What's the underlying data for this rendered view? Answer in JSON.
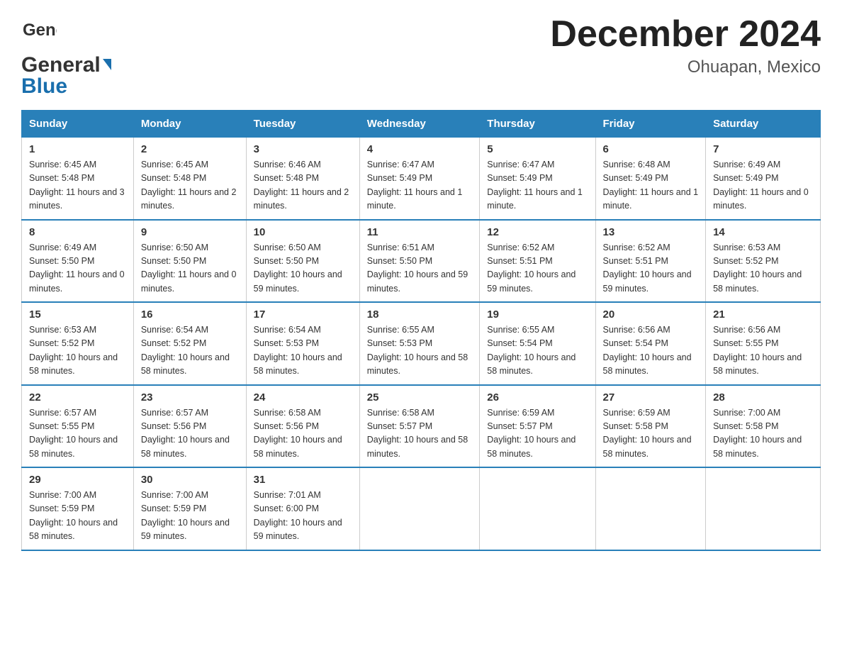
{
  "header": {
    "logo_line1": "General",
    "logo_line2": "Blue",
    "title": "December 2024",
    "subtitle": "Ohuapan, Mexico"
  },
  "days_of_week": [
    "Sunday",
    "Monday",
    "Tuesday",
    "Wednesday",
    "Thursday",
    "Friday",
    "Saturday"
  ],
  "weeks": [
    [
      {
        "day": "1",
        "sunrise": "Sunrise: 6:45 AM",
        "sunset": "Sunset: 5:48 PM",
        "daylight": "Daylight: 11 hours and 3 minutes."
      },
      {
        "day": "2",
        "sunrise": "Sunrise: 6:45 AM",
        "sunset": "Sunset: 5:48 PM",
        "daylight": "Daylight: 11 hours and 2 minutes."
      },
      {
        "day": "3",
        "sunrise": "Sunrise: 6:46 AM",
        "sunset": "Sunset: 5:48 PM",
        "daylight": "Daylight: 11 hours and 2 minutes."
      },
      {
        "day": "4",
        "sunrise": "Sunrise: 6:47 AM",
        "sunset": "Sunset: 5:49 PM",
        "daylight": "Daylight: 11 hours and 1 minute."
      },
      {
        "day": "5",
        "sunrise": "Sunrise: 6:47 AM",
        "sunset": "Sunset: 5:49 PM",
        "daylight": "Daylight: 11 hours and 1 minute."
      },
      {
        "day": "6",
        "sunrise": "Sunrise: 6:48 AM",
        "sunset": "Sunset: 5:49 PM",
        "daylight": "Daylight: 11 hours and 1 minute."
      },
      {
        "day": "7",
        "sunrise": "Sunrise: 6:49 AM",
        "sunset": "Sunset: 5:49 PM",
        "daylight": "Daylight: 11 hours and 0 minutes."
      }
    ],
    [
      {
        "day": "8",
        "sunrise": "Sunrise: 6:49 AM",
        "sunset": "Sunset: 5:50 PM",
        "daylight": "Daylight: 11 hours and 0 minutes."
      },
      {
        "day": "9",
        "sunrise": "Sunrise: 6:50 AM",
        "sunset": "Sunset: 5:50 PM",
        "daylight": "Daylight: 11 hours and 0 minutes."
      },
      {
        "day": "10",
        "sunrise": "Sunrise: 6:50 AM",
        "sunset": "Sunset: 5:50 PM",
        "daylight": "Daylight: 10 hours and 59 minutes."
      },
      {
        "day": "11",
        "sunrise": "Sunrise: 6:51 AM",
        "sunset": "Sunset: 5:50 PM",
        "daylight": "Daylight: 10 hours and 59 minutes."
      },
      {
        "day": "12",
        "sunrise": "Sunrise: 6:52 AM",
        "sunset": "Sunset: 5:51 PM",
        "daylight": "Daylight: 10 hours and 59 minutes."
      },
      {
        "day": "13",
        "sunrise": "Sunrise: 6:52 AM",
        "sunset": "Sunset: 5:51 PM",
        "daylight": "Daylight: 10 hours and 59 minutes."
      },
      {
        "day": "14",
        "sunrise": "Sunrise: 6:53 AM",
        "sunset": "Sunset: 5:52 PM",
        "daylight": "Daylight: 10 hours and 58 minutes."
      }
    ],
    [
      {
        "day": "15",
        "sunrise": "Sunrise: 6:53 AM",
        "sunset": "Sunset: 5:52 PM",
        "daylight": "Daylight: 10 hours and 58 minutes."
      },
      {
        "day": "16",
        "sunrise": "Sunrise: 6:54 AM",
        "sunset": "Sunset: 5:52 PM",
        "daylight": "Daylight: 10 hours and 58 minutes."
      },
      {
        "day": "17",
        "sunrise": "Sunrise: 6:54 AM",
        "sunset": "Sunset: 5:53 PM",
        "daylight": "Daylight: 10 hours and 58 minutes."
      },
      {
        "day": "18",
        "sunrise": "Sunrise: 6:55 AM",
        "sunset": "Sunset: 5:53 PM",
        "daylight": "Daylight: 10 hours and 58 minutes."
      },
      {
        "day": "19",
        "sunrise": "Sunrise: 6:55 AM",
        "sunset": "Sunset: 5:54 PM",
        "daylight": "Daylight: 10 hours and 58 minutes."
      },
      {
        "day": "20",
        "sunrise": "Sunrise: 6:56 AM",
        "sunset": "Sunset: 5:54 PM",
        "daylight": "Daylight: 10 hours and 58 minutes."
      },
      {
        "day": "21",
        "sunrise": "Sunrise: 6:56 AM",
        "sunset": "Sunset: 5:55 PM",
        "daylight": "Daylight: 10 hours and 58 minutes."
      }
    ],
    [
      {
        "day": "22",
        "sunrise": "Sunrise: 6:57 AM",
        "sunset": "Sunset: 5:55 PM",
        "daylight": "Daylight: 10 hours and 58 minutes."
      },
      {
        "day": "23",
        "sunrise": "Sunrise: 6:57 AM",
        "sunset": "Sunset: 5:56 PM",
        "daylight": "Daylight: 10 hours and 58 minutes."
      },
      {
        "day": "24",
        "sunrise": "Sunrise: 6:58 AM",
        "sunset": "Sunset: 5:56 PM",
        "daylight": "Daylight: 10 hours and 58 minutes."
      },
      {
        "day": "25",
        "sunrise": "Sunrise: 6:58 AM",
        "sunset": "Sunset: 5:57 PM",
        "daylight": "Daylight: 10 hours and 58 minutes."
      },
      {
        "day": "26",
        "sunrise": "Sunrise: 6:59 AM",
        "sunset": "Sunset: 5:57 PM",
        "daylight": "Daylight: 10 hours and 58 minutes."
      },
      {
        "day": "27",
        "sunrise": "Sunrise: 6:59 AM",
        "sunset": "Sunset: 5:58 PM",
        "daylight": "Daylight: 10 hours and 58 minutes."
      },
      {
        "day": "28",
        "sunrise": "Sunrise: 7:00 AM",
        "sunset": "Sunset: 5:58 PM",
        "daylight": "Daylight: 10 hours and 58 minutes."
      }
    ],
    [
      {
        "day": "29",
        "sunrise": "Sunrise: 7:00 AM",
        "sunset": "Sunset: 5:59 PM",
        "daylight": "Daylight: 10 hours and 58 minutes."
      },
      {
        "day": "30",
        "sunrise": "Sunrise: 7:00 AM",
        "sunset": "Sunset: 5:59 PM",
        "daylight": "Daylight: 10 hours and 59 minutes."
      },
      {
        "day": "31",
        "sunrise": "Sunrise: 7:01 AM",
        "sunset": "Sunset: 6:00 PM",
        "daylight": "Daylight: 10 hours and 59 minutes."
      },
      {
        "day": "",
        "sunrise": "",
        "sunset": "",
        "daylight": ""
      },
      {
        "day": "",
        "sunrise": "",
        "sunset": "",
        "daylight": ""
      },
      {
        "day": "",
        "sunrise": "",
        "sunset": "",
        "daylight": ""
      },
      {
        "day": "",
        "sunrise": "",
        "sunset": "",
        "daylight": ""
      }
    ]
  ]
}
